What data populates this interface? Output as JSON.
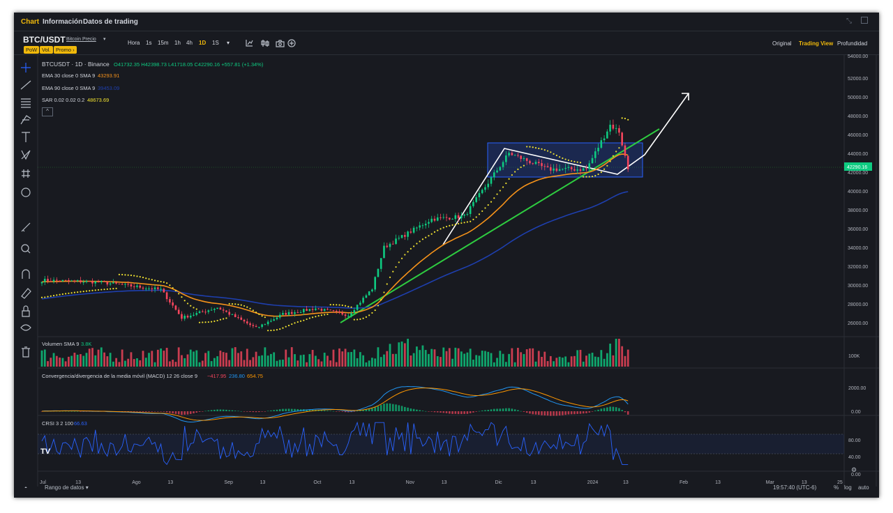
{
  "tabs": [
    {
      "label": "Chart",
      "active": true
    },
    {
      "label": "Información",
      "active": false
    },
    {
      "label": "Datos de trading",
      "active": false
    }
  ],
  "symbol": {
    "pair": "BTC/USDT",
    "link": "Bitcoin Precio",
    "pills": [
      "PoW",
      "Vol.",
      "Promo ›"
    ]
  },
  "intervals": [
    {
      "label": "Hora",
      "active": false
    },
    {
      "label": "1s",
      "active": false
    },
    {
      "label": "15m",
      "active": false
    },
    {
      "label": "1h",
      "active": false
    },
    {
      "label": "4h",
      "active": false
    },
    {
      "label": "1D",
      "active": true
    },
    {
      "label": "1S",
      "active": false
    },
    {
      "label": "▾",
      "active": false
    }
  ],
  "views": [
    {
      "label": "Original",
      "active": false
    },
    {
      "label": "Trading View",
      "active": true
    },
    {
      "label": "Profundidad",
      "active": false
    }
  ],
  "legend": {
    "title": "BTCUSDT · 1D · Binance",
    "ohlc": "O41732.35 H42398.73 L41718.05 C42290.16 +557.81 (+1.34%)",
    "ema30_label": "EMA 30 close 0 SMA 9",
    "ema30_value": "43293.91",
    "ema90_label": "EMA 90 close 0 SMA 9",
    "ema90_value": "39453.09",
    "sar_label": "SAR 0.02 0.02 0.2",
    "sar_value": "48673.69",
    "volume_label": "Volumen SMA 9",
    "volume_value": "3.8K",
    "macd_label": "Convergencia/divergencia de la media móvil (MACD) 12 26 close 9",
    "macd_v1": "−417.95",
    "macd_v2": "236.80",
    "macd_v3": "654.75",
    "crsi_label": "CRSI 3 2 100",
    "crsi_value": "66.63"
  },
  "colors": {
    "up": "#0ecb81",
    "down": "#f6465d",
    "ema30": "#f7931a",
    "ema90": "#1e3fae",
    "sar": "#f0e130",
    "trendline": "#2ecc40",
    "accent": "#f0b90b",
    "macd_line": "#2196f3",
    "signal_line": "#ff9800",
    "crsi": "#2962ff",
    "box": "#1e3a8a"
  },
  "footer": {
    "range": "Rango de datos",
    "time": "19:57:40 (UTC-6)",
    "pct": "%",
    "log": "log",
    "auto": "auto"
  },
  "chart_data": {
    "type": "candlestick",
    "ylim": [
      24500,
      54500
    ],
    "yticks": [
      26000,
      28000,
      30000,
      32000,
      34000,
      36000,
      38000,
      40000,
      42000,
      44000,
      46000,
      48000,
      50000,
      52000
    ],
    "ytick_labels": [
      "26000.00",
      "28000.00",
      "30000.00",
      "32000.00",
      "34000.00",
      "36000.00",
      "38000.00",
      "40000.00",
      "42000.00",
      "44000.00",
      "46000.00",
      "48000.00",
      "50000.00",
      "52000.00"
    ],
    "ytop_label": "54000.00",
    "last_price_label": "42290.16",
    "last_price": 42290.16,
    "xticks": [
      "Jul",
      "13",
      "Ago",
      "13",
      "Sep",
      "13",
      "Oct",
      "13",
      "Nov",
      "13",
      "Dic",
      "13",
      "2024",
      "13",
      "Feb",
      "13",
      "Mar",
      "13",
      "25"
    ],
    "anchors": [
      {
        "date": "2023-07-01",
        "price": 30500
      },
      {
        "date": "2023-07-20",
        "price": 30300
      },
      {
        "date": "2023-08-10",
        "price": 29500
      },
      {
        "date": "2023-08-17",
        "price": 26500
      },
      {
        "date": "2023-08-29",
        "price": 27600
      },
      {
        "date": "2023-09-11",
        "price": 25400
      },
      {
        "date": "2023-09-20",
        "price": 26900
      },
      {
        "date": "2023-10-01",
        "price": 27500
      },
      {
        "date": "2023-10-12",
        "price": 26800
      },
      {
        "date": "2023-10-20",
        "price": 29600
      },
      {
        "date": "2023-10-24",
        "price": 34000
      },
      {
        "date": "2023-11-09",
        "price": 37000
      },
      {
        "date": "2023-11-20",
        "price": 37300
      },
      {
        "date": "2023-12-05",
        "price": 44000
      },
      {
        "date": "2023-12-18",
        "price": 42300
      },
      {
        "date": "2023-12-31",
        "price": 42300
      },
      {
        "date": "2024-01-08",
        "price": 47000
      },
      {
        "date": "2024-01-11",
        "price": 46300
      },
      {
        "date": "2024-01-14",
        "price": 42300
      }
    ],
    "volume": {
      "ylabel": "100K"
    },
    "macd": {
      "ytick_labels": [
        "2000.00",
        "0.00"
      ]
    },
    "crsi": {
      "ytick_labels": [
        "80.00",
        "40.00",
        "0.00"
      ]
    }
  }
}
